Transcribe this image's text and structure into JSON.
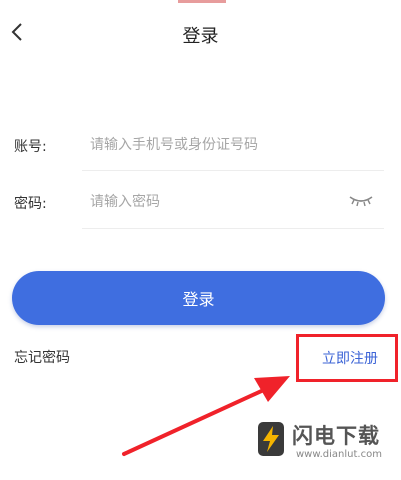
{
  "header": {
    "title": "登录"
  },
  "form": {
    "account_label": "账号:",
    "account_placeholder": "请输入手机号或身份证号码",
    "password_label": "密码:",
    "password_placeholder": "请输入密码"
  },
  "actions": {
    "login_label": "登录",
    "forgot_label": "忘记密码",
    "register_label": "立即注册"
  },
  "watermark": {
    "name": "闪电下载",
    "url": "www.dianlut.com"
  },
  "colors": {
    "primary": "#3f6ee0",
    "link": "#3b63d6",
    "highlight": "#f0222a"
  },
  "icons": {
    "back": "chevron-left-icon",
    "password_toggle": "eye-closed-icon",
    "watermark_logo": "lightning-logo"
  }
}
